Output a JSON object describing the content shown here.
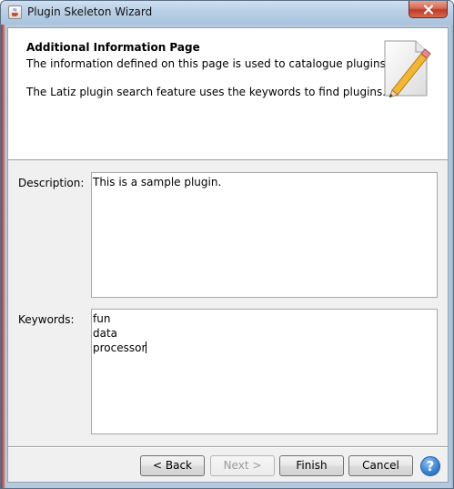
{
  "window": {
    "title": "Plugin Skeleton Wizard",
    "icon": "java-cup-icon"
  },
  "header": {
    "title": "Additional Information Page",
    "line1": "The information defined on this page is used to catalogue plugins.",
    "line2": "The Latiz plugin search feature uses the keywords to find plugins.",
    "icon": "pencil-notepad-icon"
  },
  "form": {
    "description_label": "Description:",
    "description_value": "This is a sample plugin.",
    "keywords_label": "Keywords:",
    "keywords_lines": [
      "fun",
      "data",
      "processor"
    ]
  },
  "buttons": {
    "back": "< Back",
    "next": "Next >",
    "finish": "Finish",
    "cancel": "Cancel",
    "help": "?"
  }
}
